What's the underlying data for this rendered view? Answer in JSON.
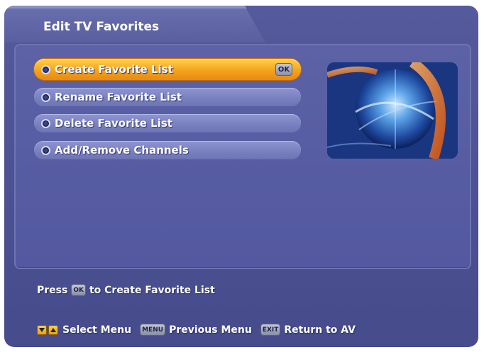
{
  "header": {
    "title": "Edit TV Favorites"
  },
  "menu": {
    "items": [
      {
        "label": "Create Favorite List",
        "selected": true
      },
      {
        "label": "Rename Favorite List",
        "selected": false
      },
      {
        "label": "Delete Favorite List",
        "selected": false
      },
      {
        "label": "Add/Remove Channels",
        "selected": false
      }
    ],
    "ok_badge": "OK"
  },
  "hint": {
    "prefix": "Press",
    "key": "OK",
    "suffix": "to Create Favorite List"
  },
  "footer": {
    "select_label": "Select Menu",
    "menu_key": "MENU",
    "menu_label": "Previous Menu",
    "exit_key": "EXIT",
    "exit_label": "Return to AV"
  },
  "colors": {
    "background": "#4c5293",
    "selected_item": "#f4a31c",
    "item": "#7a81c0",
    "text": "#ffffff"
  },
  "icons": {
    "nav_down": "arrow-down-icon",
    "nav_up": "arrow-up-icon",
    "bullet": "bullet-icon"
  }
}
